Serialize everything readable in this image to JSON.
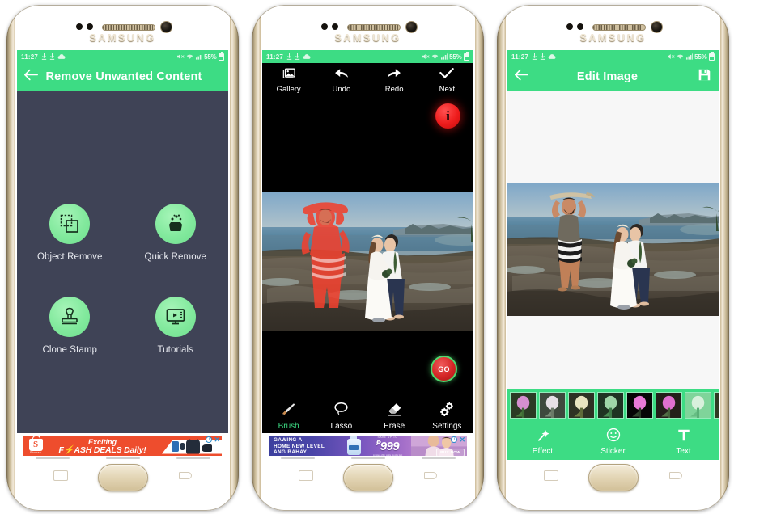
{
  "device": {
    "brand": "SAMSUNG"
  },
  "statusbar": {
    "time": "11:27",
    "battery_percent": "55%",
    "icons": [
      "download-icon",
      "download-icon",
      "cloud-icon",
      "more-icon",
      "mute-icon",
      "wifi-icon",
      "signal-icon",
      "battery-icon"
    ]
  },
  "colors": {
    "accent_green": "#3ddc84",
    "icon_green": "#82e99d",
    "dark_bg": "#3f4356",
    "go_red": "#d42626",
    "info_red": "#ee1c1c",
    "ad_orange": "#ee4d2d"
  },
  "phone1": {
    "appbar": {
      "title": "Remove Unwanted Content",
      "back_icon": "arrow-left-icon"
    },
    "menu": [
      {
        "label": "Object Remove",
        "icon": "object-remove-icon"
      },
      {
        "label": "Quick Remove",
        "icon": "quick-remove-icon"
      },
      {
        "label": "Clone Stamp",
        "icon": "clone-stamp-icon"
      },
      {
        "label": "Tutorials",
        "icon": "tutorials-icon"
      }
    ],
    "ad": {
      "brand": "Shopee",
      "line1": "Exciting",
      "line2_pre": "F",
      "line2_bolt": "⚡",
      "line2_post": "ASH DEALS Daily!",
      "info_badge": "i",
      "close_badge": "✕"
    }
  },
  "phone2": {
    "top_tools": [
      {
        "label": "Gallery",
        "icon": "gallery-icon"
      },
      {
        "label": "Undo",
        "icon": "undo-icon"
      },
      {
        "label": "Redo",
        "icon": "redo-icon"
      },
      {
        "label": "Next",
        "icon": "check-icon"
      }
    ],
    "info_button": {
      "label": "i",
      "name": "info-button"
    },
    "go_button": {
      "label": "GO"
    },
    "bottom_tools": [
      {
        "label": "Brush",
        "icon": "brush-icon",
        "active": true
      },
      {
        "label": "Lasso",
        "icon": "lasso-icon",
        "active": false
      },
      {
        "label": "Erase",
        "icon": "eraser-icon",
        "active": false
      },
      {
        "label": "Settings",
        "icon": "settings-gear-icon",
        "active": false
      }
    ],
    "canvas": {
      "description": "Beach wedding photo with photobomber masked in red"
    }
  },
  "phone3": {
    "appbar": {
      "title": "Edit Image",
      "back_icon": "arrow-left-icon",
      "save_icon": "save-icon"
    },
    "filters_count": 8,
    "tools": [
      {
        "label": "Effect",
        "icon": "magic-wand-icon"
      },
      {
        "label": "Sticker",
        "icon": "smiley-icon"
      },
      {
        "label": "Text",
        "icon": "text-icon"
      }
    ],
    "canvas": {
      "description": "Beach wedding photo, original with photobomber"
    }
  },
  "ad_gawing": {
    "line1": "GAWING A",
    "line2": "HOME NEW LEVEL",
    "line3": "ANG BAHAY",
    "price_caption": "SAVE UP TO",
    "currency": "₱",
    "price": "999",
    "fine_print": "Limited offer while stocks last",
    "cta": "BUY NOW",
    "info_badge": "i",
    "close_badge": "✕"
  }
}
